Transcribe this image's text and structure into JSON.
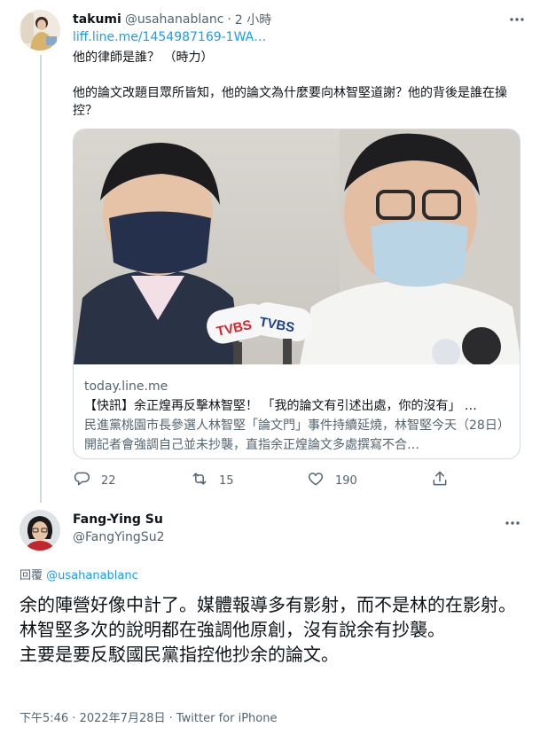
{
  "parent_tweet": {
    "author_name": "takumi",
    "author_handle": "@usahanablanc",
    "separator": "·",
    "timestamp": "2 小時",
    "link": "liff.line.me/1454987169-1WA…",
    "text_line1": "他的律師是誰？ （時力）",
    "text_line2": "他的論文改題目眾所皆知，他的論文為什麼要向林智堅道謝？他的背後是誰在操控？",
    "card": {
      "domain": "today.line.me",
      "title": "【快訊】余正煌再反擊林智堅！ 「我的論文有引述出處，你的沒有」 …",
      "description": "民進黨桃園市長參選人林智堅「論文門」事件持續延燒，林智堅今天（28日）開記者會強調自己並未抄襲，直指余正煌論文多處撰寫不合…",
      "mic_label_left": "TVBS",
      "mic_label_right": "TVBS"
    },
    "actions": {
      "reply_count": "22",
      "retweet_count": "15",
      "like_count": "190"
    }
  },
  "reply_tweet": {
    "author_name": "Fang-Ying Su",
    "author_handle": "@FangYingSu2",
    "replying_prefix": "回覆",
    "replying_to": "@usahanablanc",
    "text_line1": "余的陣營好像中計了。媒體報導多有影射，而不是林的在影射。",
    "text_line2": "林智堅多次的說明都在強調他原創，沒有說余有抄襲。",
    "text_line3": "主要是要反駁國民黨指控他抄余的論文。",
    "meta": "下午5:46 · 2022年7月28日 · Twitter for iPhone"
  },
  "colors": {
    "accent": "#1d9bf0",
    "secondary_text": "#536471",
    "border": "#cfd9de"
  },
  "icons": [
    "more-icon",
    "reply-icon",
    "retweet-icon",
    "like-icon",
    "share-icon"
  ]
}
